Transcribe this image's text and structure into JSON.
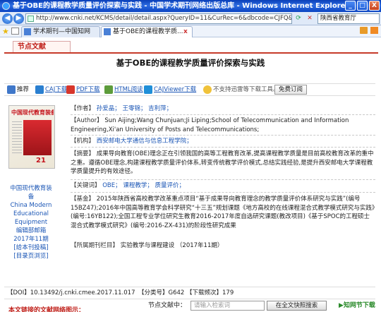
{
  "window": {
    "title": "基于OBE的课程教学质量评价探索与实践 - 中国学术期刊网络出版总库 - Windows Internet Explorer",
    "controls": [
      "_",
      "□",
      "X"
    ]
  },
  "address": {
    "url": "http://www.cnki.net/KCMS/detail/detail.aspx?QueryID=11&CurRec=6&dbcode=CJFQ&dbname=CJFD",
    "search_box": "陕西省教育厅"
  },
  "tabs": [
    {
      "label": "学术期刊—中国知网"
    },
    {
      "label": "基于OBE的课程教学质..."
    }
  ],
  "page": {
    "node_tab": "节点文献",
    "title": "基于OBE的课程教学质量评价探索与实践"
  },
  "toolbar": {
    "recommend": "推荐",
    "caj": "CAJ下载",
    "pdf": "PDF下载",
    "html": "HTML阅读",
    "cajviewer": "CAJViewer下载",
    "share_note": "不支持迅雷等下载工具。",
    "subscribe": "免费订阅"
  },
  "cover": {
    "masthead": "中国现代教育装备",
    "issue": "21"
  },
  "journal": {
    "name_cn": "中国现代教育装备",
    "name_en": "China Modern Educational Equipment",
    "board": "编辑部邮箱",
    "issue": "2017年11期",
    "toc": "[给本刊投稿]",
    "browse": "[目录页浏览]"
  },
  "record": {
    "authors_label": "【作者】",
    "authors": [
      "孙爱晶；",
      "王零锦；",
      "吉利萍；"
    ],
    "author_en_label": "【Author】",
    "author_en": "Sun Aijing;Wang Chunjuan;Ji Liping;School of Telecommunication and Information Engineering,Xi'an University of Posts and Telecommunications;",
    "org_label": "【机构】",
    "org": "西安邮电大学通信与信息工程学院；",
    "abstract_label": "【摘要】",
    "abstract": "成果导向教育(OBE)理念正在引领我国的高等工程教育改革,提高课程教学质量是目前高校教育改革的重中之重。遵循OBE理念,构建课程教学质量评价体系,转变传统教学评价模式,总结实践经验,是提升西安邮电大学课程教学质量提升的有效途径。",
    "keywords_label": "【关键词】",
    "keywords": [
      "OBE；",
      "课程教学；",
      "质量评价；"
    ],
    "fund_label": "【基金】",
    "fund": "2015年陕西省高校教学改革重点项目“基于成果导向教育理念的教学质量评价体系研究与实践”(编号15BZ47);2016年中国高等教育学会科学研究“十三五”规划课题《地方高校的在线课程混合式教学模式研究与实践》(编号:16YB122);全国工程专业学位研究生教育2016-2017年度自选研究课题(教改项目)《基于SPOC的工程硕士混合式教学模式研究》(编号:2016-ZX-431)的阶段性研究成果",
    "column_label": "【所属期刊栏目】",
    "column": "实验教学与课程建设 （2017年11期）"
  },
  "meta": {
    "doi_label": "【DOI】",
    "doi": "10.13492/j.cnki.cmee.2017.11.017",
    "cls_label": "【分类号】",
    "cls": "G642",
    "dl_label": "【下载频次】",
    "dl": "179"
  },
  "search": {
    "label": "节点文献中：",
    "placeholder": "请输入检索词",
    "button": "在全文快照搜索",
    "next": "知网节下载"
  },
  "bottom_tab": "本文链接的文献网络图示："
}
